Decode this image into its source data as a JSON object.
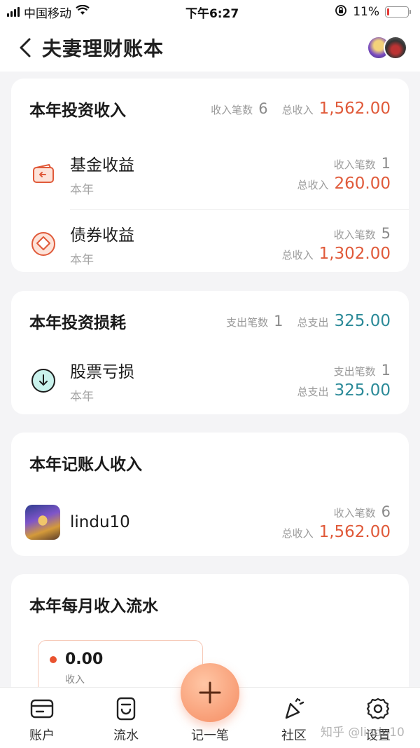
{
  "status_bar": {
    "carrier": "中国移动",
    "time": "下午6:27",
    "battery": "11%",
    "battery_level": 0.11
  },
  "header": {
    "title": "夫妻理财账本"
  },
  "investment_income": {
    "title": "本年投资收入",
    "count_label": "收入笔数",
    "count": "6",
    "total_label": "总收入",
    "total": "1,562.00",
    "items": [
      {
        "name": "基金收益",
        "period": "本年",
        "count_label": "收入笔数",
        "count": "1",
        "total_label": "总收入",
        "total": "260.00"
      },
      {
        "name": "债券收益",
        "period": "本年",
        "count_label": "收入笔数",
        "count": "5",
        "total_label": "总收入",
        "total": "1,302.00"
      }
    ]
  },
  "investment_loss": {
    "title": "本年投资损耗",
    "count_label": "支出笔数",
    "count": "1",
    "total_label": "总支出",
    "total": "325.00",
    "items": [
      {
        "name": "股票亏损",
        "period": "本年",
        "count_label": "支出笔数",
        "count": "1",
        "total_label": "总支出",
        "total": "325.00"
      }
    ]
  },
  "bookkeeper_income": {
    "title": "本年记账人收入",
    "items": [
      {
        "name": "lindu10",
        "count_label": "收入笔数",
        "count": "6",
        "total_label": "总收入",
        "total": "1,562.00"
      }
    ]
  },
  "monthly_income": {
    "title": "本年每月收入流水",
    "value": "0.00",
    "label": "收入"
  },
  "tabs": [
    {
      "label": "账户",
      "icon": "wallet-icon"
    },
    {
      "label": "流水",
      "icon": "receipt-icon"
    },
    {
      "label": "记一笔",
      "icon": "plus-icon"
    },
    {
      "label": "社区",
      "icon": "party-popper-icon"
    },
    {
      "label": "设置",
      "icon": "gear-icon"
    }
  ],
  "watermark": "知乎 @lindu10",
  "colors": {
    "income": "#e05a3a",
    "expense": "#2b8a98",
    "accent": "#f58c62"
  }
}
